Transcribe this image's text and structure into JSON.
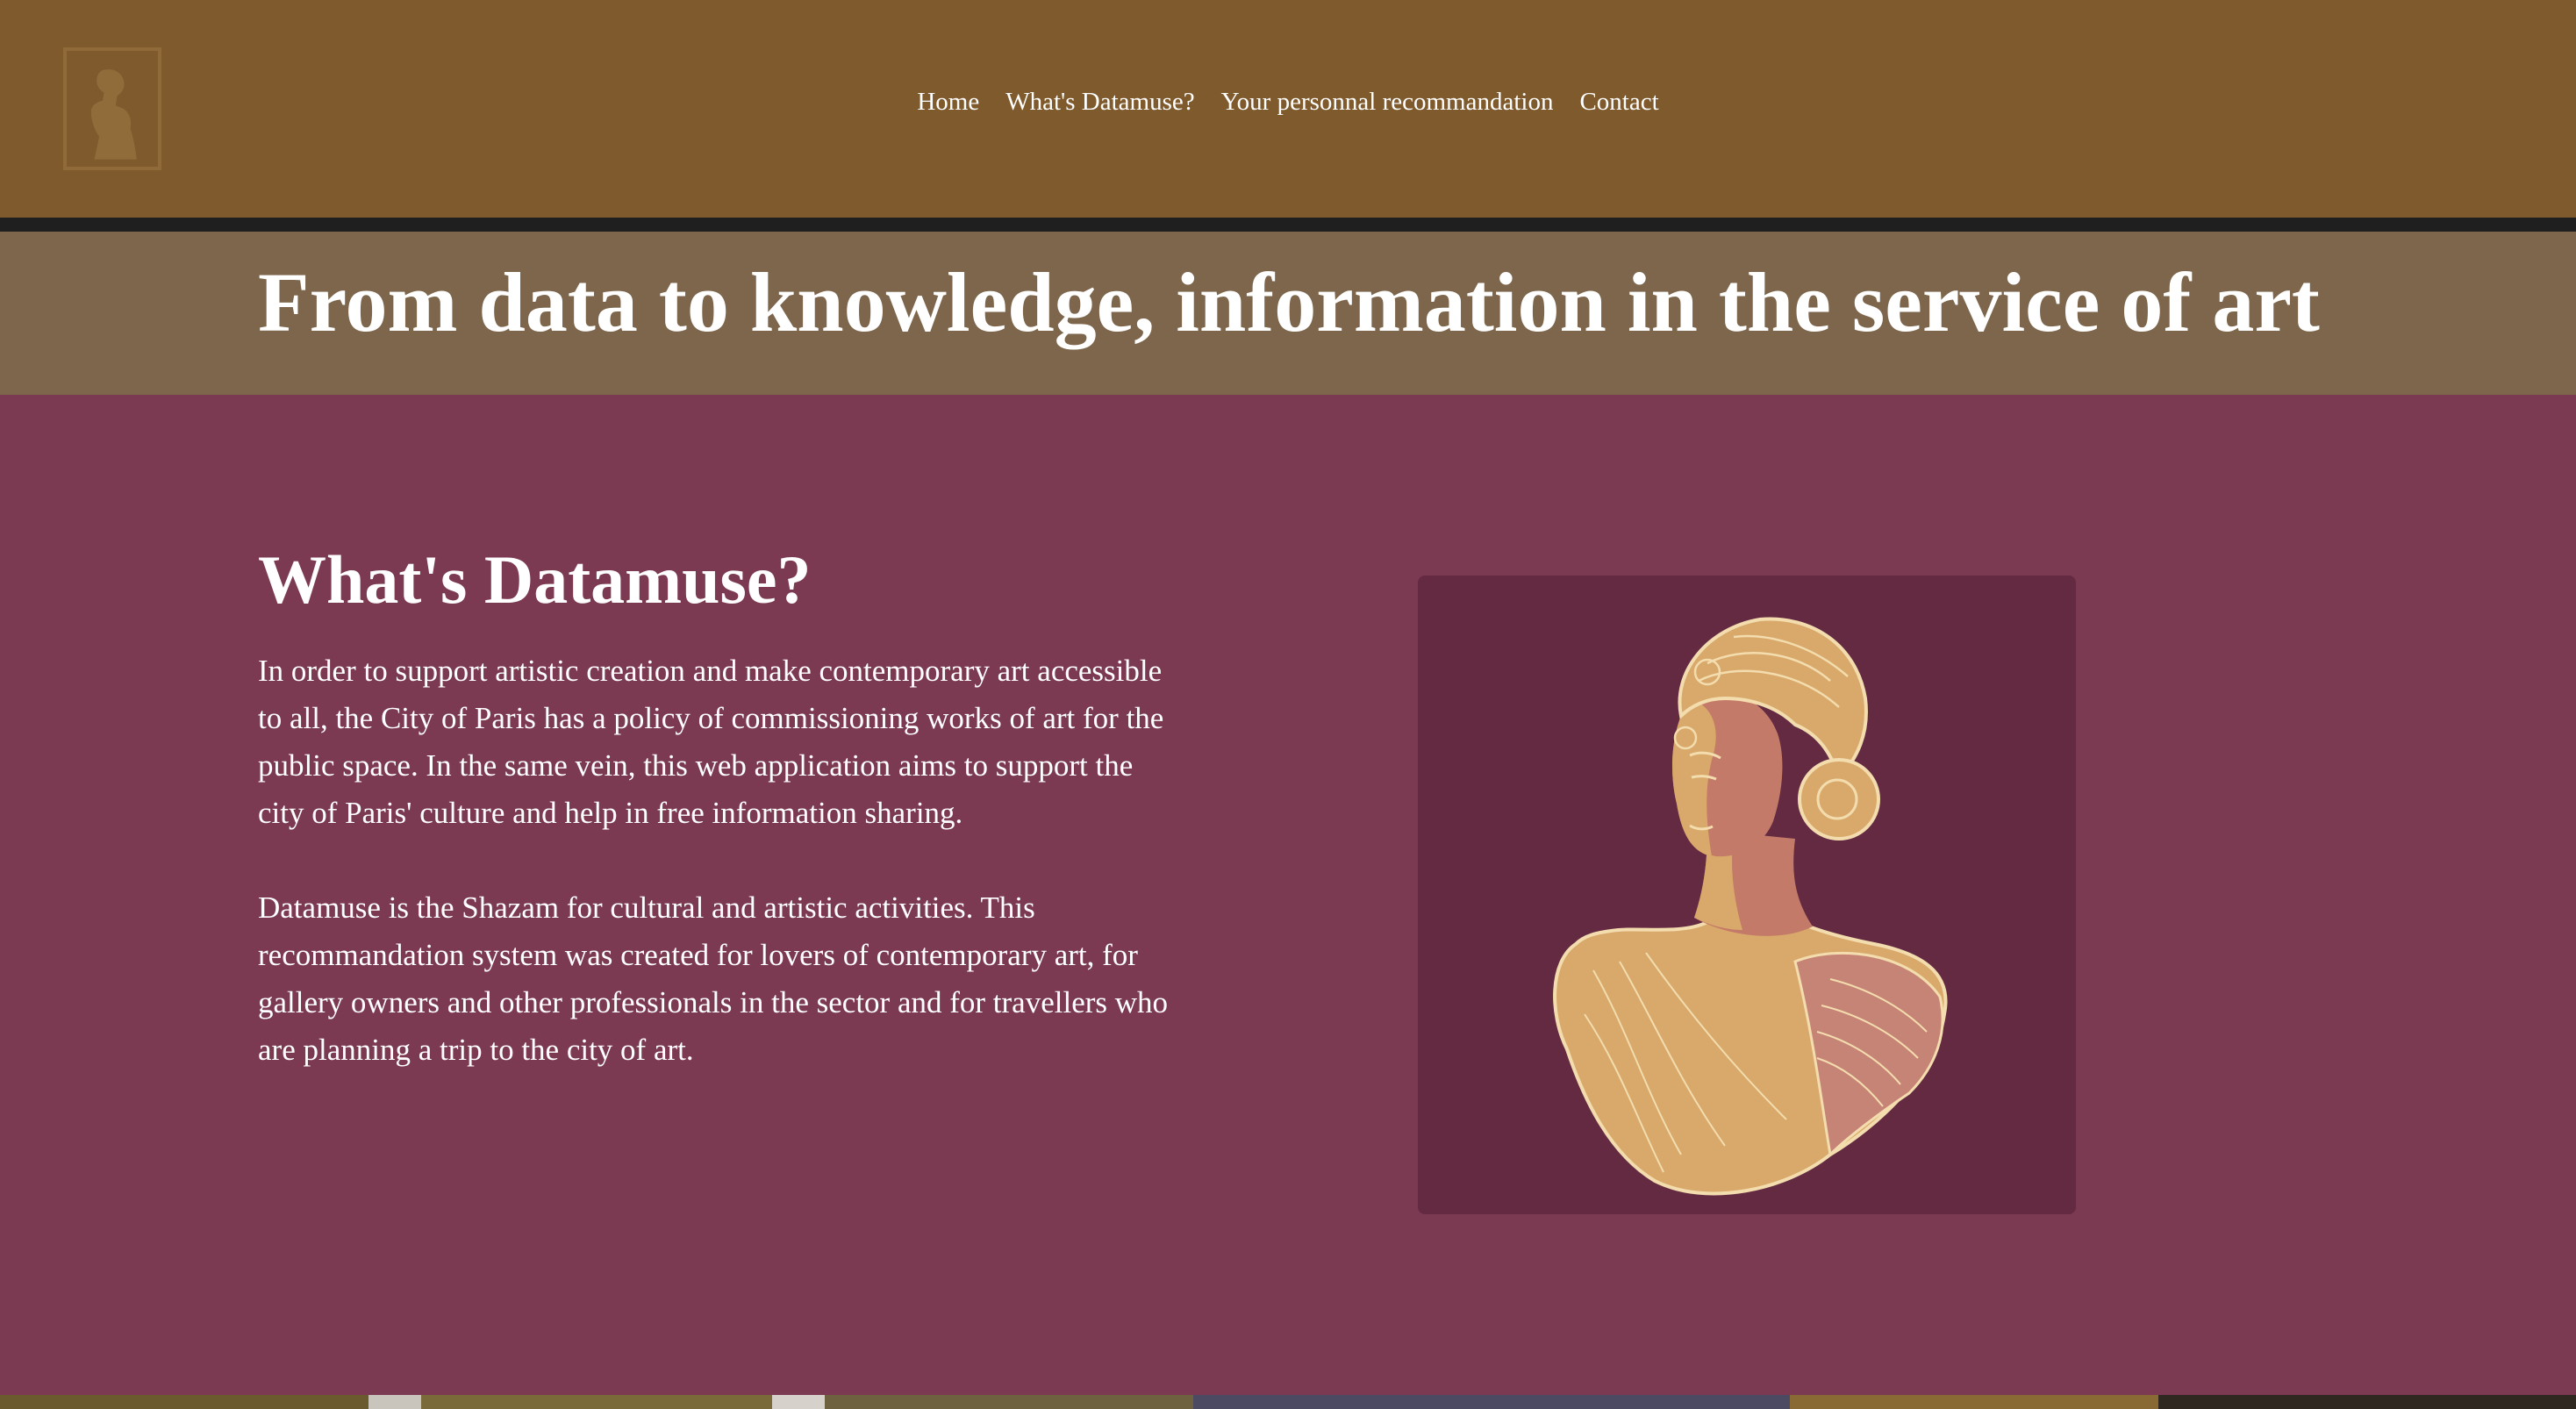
{
  "nav": {
    "items": [
      {
        "label": "Home"
      },
      {
        "label": "What's Datamuse?"
      },
      {
        "label": "Your personnal recommandation"
      },
      {
        "label": "Contact"
      }
    ]
  },
  "logo": {
    "icon": "bust-logo-icon"
  },
  "hero": {
    "title": "From data to knowledge, information in the service of art"
  },
  "about": {
    "heading": "What's Datamuse?",
    "paragraphs": [
      "In order to support artistic creation and make contemporary art accessible to all, the City of Paris has a policy of commissioning works of art for the public space. In the same vein, this web application aims to support the city of Paris' culture and help in free information sharing.",
      "Datamuse is the Shazam for cultural and artistic activities. This recommandation system was created for lovers of contemporary art, for gallery owners and other professionals in the sector and for travellers who are planning a trip to the city of art."
    ],
    "illustration": "bust-illustration"
  },
  "colors": {
    "header": "#7f5a2d",
    "hero": "#7d664c",
    "main": "#7c3a52",
    "illustration_bg": "#632a42",
    "bust_gold": "#d8a96a",
    "bust_rose": "#b87062"
  }
}
